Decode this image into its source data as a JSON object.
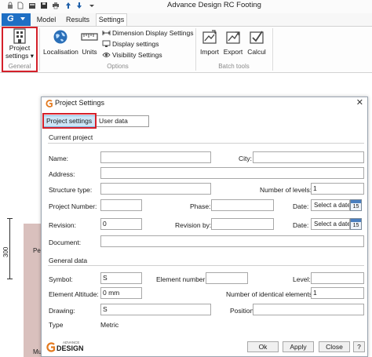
{
  "app": {
    "title": "Advance Design RC Footing",
    "app_button": "G"
  },
  "ribbon": {
    "tabs": [
      {
        "label": "Model"
      },
      {
        "label": "Results"
      },
      {
        "label": "Settings",
        "active": true
      }
    ],
    "groups": {
      "general": {
        "label": "General",
        "project_settings_line1": "Project",
        "project_settings_line2": "settings"
      },
      "options": {
        "label": "Options",
        "localisation": "Localisation",
        "units": "Units",
        "dimension_display": "Dimension Display Settings",
        "display_settings": "Display settings",
        "visibility_settings": "Visibility Settings"
      },
      "batch_tools": {
        "label": "Batch tools",
        "import": "Import",
        "export": "Export",
        "calcul": "Calcul"
      }
    }
  },
  "background": {
    "dimension": "300",
    "label_pe": "Pe",
    "label_mu": "Mu"
  },
  "dialog": {
    "title": "Project Settings",
    "tabs": [
      {
        "label": "Project settings",
        "selected": true
      },
      {
        "label": "User data"
      }
    ],
    "current_project": {
      "heading": "Current project",
      "name_label": "Name:",
      "name_value": "",
      "city_label": "City:",
      "city_value": "",
      "address_label": "Address:",
      "address_value": "",
      "structure_type_label": "Structure type:",
      "structure_type_value": "",
      "number_of_levels_label": "Number of levels:",
      "number_of_levels_value": "1",
      "project_number_label": "Project Number:",
      "project_number_value": "",
      "phase_label": "Phase:",
      "phase_value": "",
      "date1_label": "Date:",
      "date1_placeholder": "Select a date",
      "revision_label": "Revision:",
      "revision_value": "0",
      "revision_by_label": "Revision by:",
      "revision_by_value": "",
      "date2_label": "Date:",
      "date2_placeholder": "Select a date",
      "document_label": "Document:",
      "document_value": "",
      "calendar_day": "15"
    },
    "general_data": {
      "heading": "General data",
      "symbol_label": "Symbol:",
      "symbol_value": "S",
      "element_number_label": "Element number",
      "element_number_value": "",
      "level_label": "Level:",
      "level_value": "",
      "element_altitude_label": "Element Altitude:",
      "element_altitude_value": "0 mm",
      "identical_elements_label": "Number of identical elements",
      "identical_elements_value": "1",
      "drawing_label": "Drawing:",
      "drawing_value": "S",
      "position_label": "Position:",
      "position_value": "",
      "type_label": "Type",
      "type_value": "Metric"
    },
    "buttons": {
      "ok": "Ok",
      "apply": "Apply",
      "close": "Close",
      "help": "?"
    },
    "logo_small": "ADVANCE",
    "logo_big": "DESIGN"
  },
  "colors": {
    "accent": "#1e6fc4",
    "highlight_box": "#d4202a",
    "tab_selected": "#cde6f7",
    "logo_orange": "#e37a1f"
  }
}
